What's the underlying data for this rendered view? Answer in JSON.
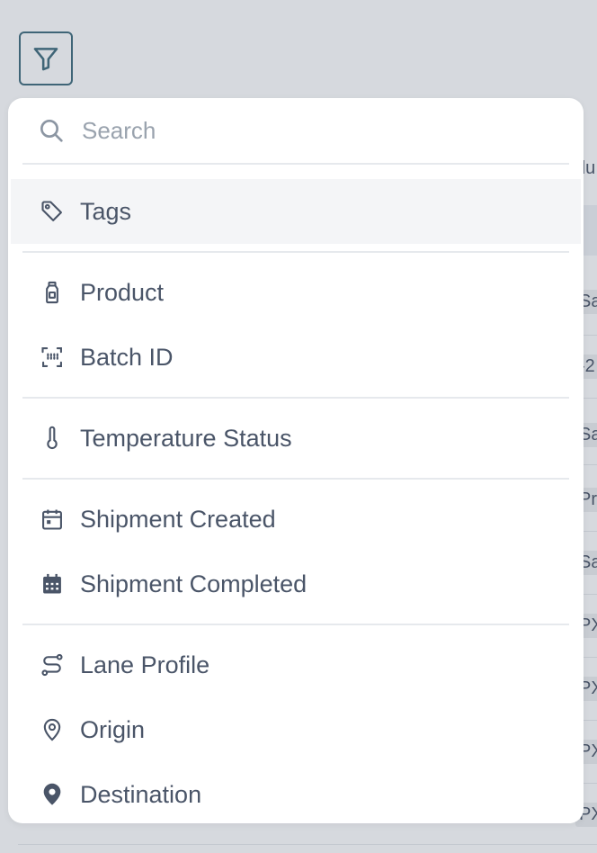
{
  "background": {
    "header_fragment": "du",
    "row_fragments": [
      "Sa",
      "-2",
      "Sa",
      "Pr",
      "Sa",
      "PX",
      "PX",
      "PX",
      "PX"
    ]
  },
  "filter_button": {
    "icon": "filter-icon"
  },
  "dropdown": {
    "search": {
      "placeholder": "Search",
      "value": "",
      "icon": "search-icon"
    },
    "items": [
      {
        "label": "Tags",
        "icon": "tag-icon",
        "active": true
      },
      {
        "label": "Product",
        "icon": "bottle-icon"
      },
      {
        "label": "Batch ID",
        "icon": "barcode-scan-icon"
      },
      {
        "label": "Temperature Status",
        "icon": "thermometer-icon"
      },
      {
        "label": "Shipment Created",
        "icon": "calendar-icon"
      },
      {
        "label": "Shipment Completed",
        "icon": "calendar-filled-icon"
      },
      {
        "label": "Lane Profile",
        "icon": "route-icon"
      },
      {
        "label": "Origin",
        "icon": "map-pin-outline-icon"
      },
      {
        "label": "Destination",
        "icon": "map-pin-filled-icon"
      }
    ]
  },
  "colors": {
    "page_bg": "#d6d9de",
    "panel_bg": "#ffffff",
    "text": "#4a5568",
    "placeholder": "#9aa3ae",
    "filter_border": "#3f6577",
    "active_row": "#f4f5f7"
  }
}
